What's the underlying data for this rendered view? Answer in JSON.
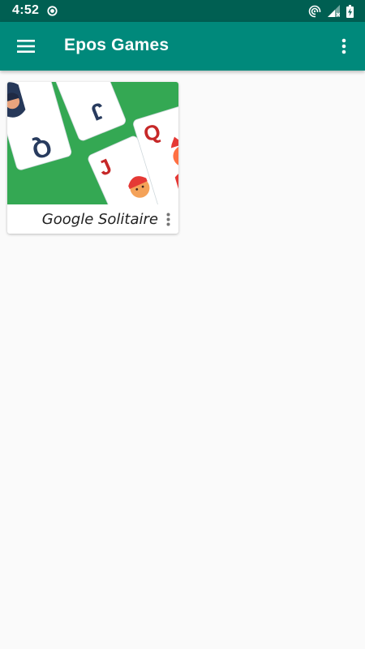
{
  "status_bar": {
    "time": "4:52",
    "icons": [
      "recording-dot-icon",
      "hotspot-icon",
      "signal-icon",
      "battery-charging-icon"
    ]
  },
  "app_bar": {
    "title": "Epos Games",
    "left_icon": "hamburger-menu-icon",
    "right_icon": "more-vert-icon"
  },
  "games": [
    {
      "title": "Google Solitaire",
      "thumbnail": "playing-cards-artwork",
      "menu_icon": "more-vert-icon"
    }
  ],
  "colors": {
    "status_bar": "#005f52",
    "app_bar": "#00897b",
    "background": "#fafafa",
    "thumbnail_green": "#34a853"
  }
}
